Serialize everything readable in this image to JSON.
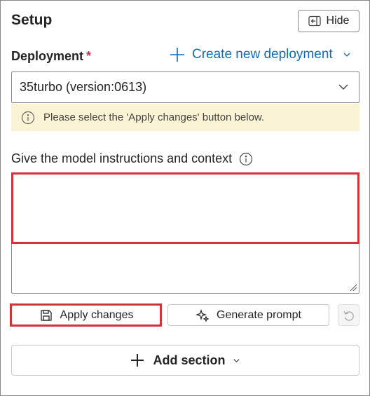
{
  "panel": {
    "title": "Setup",
    "hide_label": "Hide"
  },
  "deployment": {
    "label": "Deployment",
    "required_marker": "*",
    "create_link_label": "Create new deployment",
    "selected_value": "35turbo (version:0613)"
  },
  "banner": {
    "message": "Please select the 'Apply changes' button below."
  },
  "instructions": {
    "label": "Give the model instructions and context",
    "value": ""
  },
  "actions": {
    "apply_label": "Apply changes",
    "generate_label": "Generate prompt",
    "add_section_label": "Add section"
  },
  "colors": {
    "accent": "#0f6cbd",
    "required": "#c4314b",
    "banner_bg": "#fbf4d4",
    "highlight": "#d13438"
  },
  "icons": [
    "hide-panel-icon",
    "plus-icon",
    "chevron-down-icon",
    "info-icon",
    "save-icon",
    "sparkle-icon",
    "undo-icon",
    "resize-grip-icon"
  ]
}
